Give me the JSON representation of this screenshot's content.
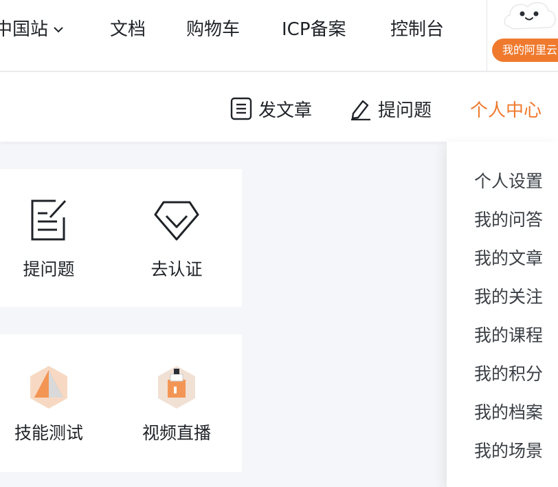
{
  "topnav": {
    "site": "中国站",
    "docs": "文档",
    "cart": "购物车",
    "icp": "ICP备案",
    "console": "控制台",
    "user_pill": "我的阿里云"
  },
  "subbar": {
    "write_article": "发文章",
    "ask_question": "提问题",
    "personal_center": "个人中心"
  },
  "cards": {
    "ask": "提问题",
    "certify": "去认证",
    "skill_test": "技能测试",
    "live": "视频直播"
  },
  "dropdown": {
    "items": [
      "个人设置",
      "我的问答",
      "我的文章",
      "我的关注",
      "我的课程",
      "我的积分",
      "我的档案",
      "我的场景"
    ]
  },
  "colors": {
    "accent": "#ef7a2e",
    "text": "#1f2328",
    "page_bg": "#f5f6f9"
  }
}
